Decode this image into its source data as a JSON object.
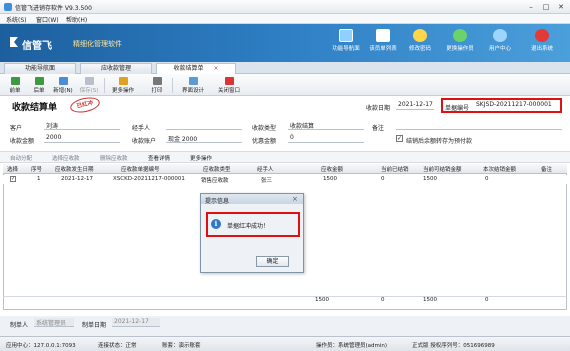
{
  "window": {
    "title": "信管飞进销存软件 V9.3.500"
  },
  "menu": [
    "系统(S)",
    "窗口(W)",
    "帮助(H)"
  ],
  "brand": {
    "name": "信管飞",
    "tagline": "精细化管理软件"
  },
  "nav": [
    {
      "label": "功能导航面",
      "icon": "monitor-icon",
      "color": "#8fd0ff"
    },
    {
      "label": "该员单列表",
      "icon": "list-icon",
      "color": "#ffffff"
    },
    {
      "label": "修改密码",
      "icon": "key-icon",
      "color": "#ffd54a"
    },
    {
      "label": "更换操作员",
      "icon": "users-icon",
      "color": "#6ad36a"
    },
    {
      "label": "用户中心",
      "icon": "user-icon",
      "color": "#9fd4ff"
    },
    {
      "label": "退出系统",
      "icon": "power-icon",
      "color": "#e53935"
    }
  ],
  "tabs": [
    "功能导航面",
    "应收款管理",
    "收款结算单"
  ],
  "toolbar": [
    "前单",
    "后单",
    "新增(N)",
    "保存(S)",
    "更多操作",
    "打印",
    "界面设计",
    "关闭窗口"
  ],
  "form": {
    "title": "收款结算单",
    "stamp": "已红冲",
    "date_label": "收款日期",
    "date_value": "2021-12-17",
    "docno_label": "单据编号",
    "docno_value": "SKJSD-20211217-000001",
    "customer_label": "客户",
    "customer_value": "刘涛",
    "handler_label": "经手人",
    "handler_value": "",
    "type_label": "收款类型",
    "type_value": "收款结算",
    "remark_label": "备注",
    "remark_value": "",
    "amount_label": "收款金额",
    "amount_value": "2000",
    "account_label": "收款账户",
    "account_value": "现金 2000",
    "discount_label": "优惠金额",
    "discount_value": "0",
    "checkbox_label": "结销后余额转存为预付款"
  },
  "subtoolbar": [
    "自动分配",
    "选择应收款",
    "删除应收款",
    "查看详情",
    "更多操作"
  ],
  "grid": {
    "headers": [
      "选择",
      "序号",
      "应收款发生日期",
      "应收款单据编号",
      "应收款类型",
      "经手人",
      "应收金额",
      "当前已结销",
      "当前可结销金额",
      "本次结销金额",
      "备注"
    ],
    "rows": [
      [
        "",
        "1",
        "2021-12-17",
        "XSCKD-20211217-000001",
        "销售应收款",
        "张三",
        "1500",
        "0",
        "1500",
        "0",
        ""
      ]
    ],
    "totals": [
      "1500",
      "0",
      "1500",
      "0"
    ]
  },
  "maker": {
    "label": "制单人",
    "value": "系统管理员",
    "date_label": "制单日期",
    "date_value": "2021-12-17"
  },
  "statusbar": [
    "应用中心：127.0.0.1:7093",
    "连接状态：正常",
    "账套：演示账套",
    "操作员：系统管理员(admin)",
    "正式版 授权序列号：051696989"
  ],
  "dialog": {
    "title": "提示信息",
    "message": "单据红冲成功！",
    "ok": "确定"
  }
}
